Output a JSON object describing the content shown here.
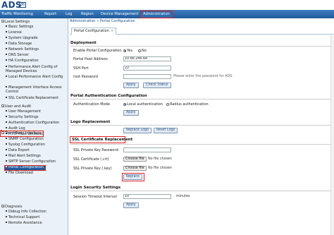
{
  "app": {
    "logo": "ADS",
    "logo_badge": "86"
  },
  "nav": {
    "items": [
      "Traffic Monitoring",
      "Report",
      "Log",
      "Region",
      "Device Management",
      "Administration"
    ]
  },
  "sidebar": {
    "groups": [
      {
        "label": "Local Settings",
        "items": [
          "Basic Settings",
          "License",
          "System Upgrade",
          "Data Storage",
          "Network Settings",
          "DNS Server",
          "HA Configuration",
          "Performance Alert Config of Managed Devices",
          "Local Performance Alert Config",
          "Management Interface Access Control",
          "SSL Certificate Replacement"
        ]
      },
      {
        "label": "User and Audit",
        "items": [
          "User Management",
          "Security Settings",
          "Authentication Configuration",
          "Audit Log",
          "HTTP Host Whitelist"
        ]
      },
      {
        "label": "Third-Party Interface",
        "items": [
          "SNMP Configuration",
          "Syslog Configuration",
          "Data Export",
          "Mail Alert Settings",
          "SMTP Server Configuration",
          "Portal Configuration",
          "File Download"
        ]
      },
      {
        "label": "Diagnosis",
        "items": [
          "Debug Info Collection",
          "Technical Support",
          "Remote Assistance"
        ]
      }
    ]
  },
  "breadcrumb": {
    "root": "Administration",
    "sep": "»",
    "current": "Portal Configuration"
  },
  "tab": {
    "label": "Portal Configuration",
    "close": "×"
  },
  "deployment": {
    "title": "Deployment",
    "enable_label": "Enable Portal Configuration",
    "yes": "Yes",
    "no": "No",
    "host_label": "Portal Host Address",
    "host_value": "10.66.246.64",
    "ssh_label": "SSH Port",
    "ssh_value": "22",
    "pwd_label": "root Password",
    "pwd_hint": "Please enter the password for ADS.",
    "apply": "Apply",
    "check_status": "Check Status"
  },
  "auth": {
    "title": "Portal Authentication Configuration",
    "mode_label": "Authentication Mode",
    "local": "Local authentication",
    "radius": "Radius authentication",
    "apply": "Apply"
  },
  "logo": {
    "title": "Logo Replacement",
    "replace": "Replace Logo",
    "reset": "Reset Logo"
  },
  "ssl": {
    "title": "SSL Certificate Replacement",
    "pk_pwd_label": "SSL Private Key Password",
    "cert_label": "SSL Certificate (.crt)",
    "key_label": "SSL Private Key (.key)",
    "choose": "Choose file",
    "no_file": "No file chosen",
    "replace": "Replace"
  },
  "login": {
    "title": "Login Security Settings",
    "timeout_label": "Session Timeout Interval",
    "timeout_value": "10",
    "unit": "minutes",
    "apply": "Apply"
  },
  "colors": {
    "nav_blue": "#1f5b9b",
    "highlight_red": "#e02020",
    "sidebar_bg": "#eaf1f8"
  }
}
